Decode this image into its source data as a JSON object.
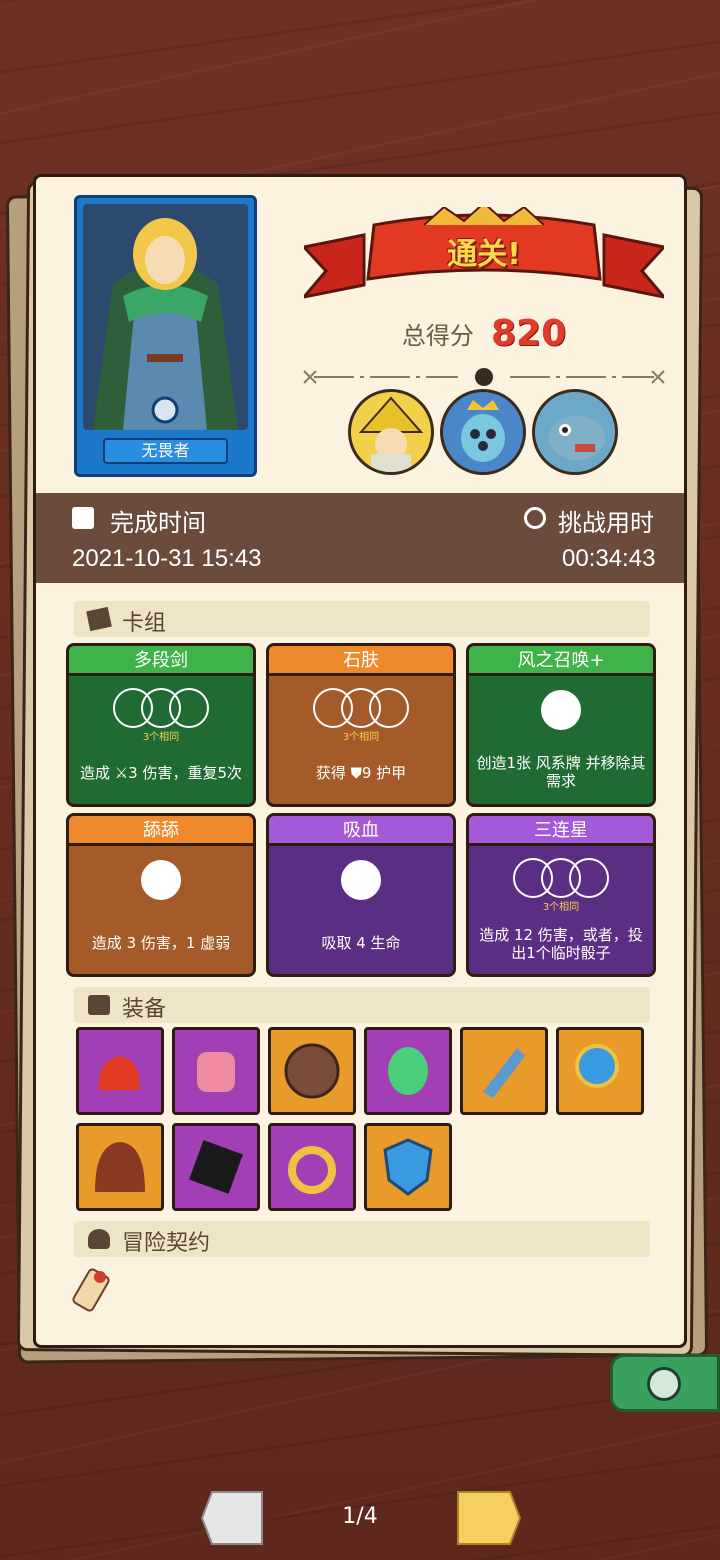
{
  "result": {
    "banner": "通关!",
    "score_label": "总得分",
    "score": "820"
  },
  "hero": {
    "name": "无畏者"
  },
  "time": {
    "finish_label": "完成时间",
    "finish_value": "2021-10-31 15:43",
    "challenge_label": "挑战用时",
    "challenge_value": "00:34:43"
  },
  "sections": {
    "deck": "卡组",
    "equipment": "装备",
    "contract": "冒险契约"
  },
  "cards": [
    {
      "title": "多段剑",
      "same": "3个相同",
      "desc": "造成 ⚔3 伤害，重复5次",
      "color": "green"
    },
    {
      "title": "石肤",
      "same": "3个相同",
      "desc": "获得 ⛊9 护甲",
      "color": "orange"
    },
    {
      "title": "风之召唤+",
      "same": "",
      "desc": "创造1张 风系牌 并移除其需求",
      "color": "green"
    },
    {
      "title": "舔舔",
      "same": "",
      "desc": "造成 3 伤害，1 虚弱",
      "color": "orange"
    },
    {
      "title": "吸血",
      "same": "",
      "desc": "吸取 4 生命",
      "color": "purple"
    },
    {
      "title": "三连星",
      "same": "3个相同",
      "desc": "造成 12 伤害，或者，投出1个临时骰子",
      "color": "purple"
    }
  ],
  "equipment": [
    {
      "name": "red-potion-icon",
      "bg": "purple"
    },
    {
      "name": "pink-jelly-icon",
      "bg": "purple"
    },
    {
      "name": "bronze-plate-icon",
      "bg": "orange"
    },
    {
      "name": "green-leaf-icon",
      "bg": "purple"
    },
    {
      "name": "saw-blade-icon",
      "bg": "orange"
    },
    {
      "name": "blue-orb-icon",
      "bg": "orange"
    },
    {
      "name": "hood-icon",
      "bg": "orange"
    },
    {
      "name": "shadow-dice-icon",
      "bg": "purple"
    },
    {
      "name": "gold-ring-icon",
      "bg": "purple"
    },
    {
      "name": "crystal-shield-icon",
      "bg": "orange"
    }
  ],
  "pager": {
    "text": "1/4"
  }
}
